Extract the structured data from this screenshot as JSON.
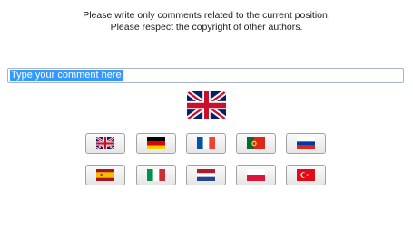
{
  "notice": {
    "line1": "Please write only comments related to the current position.",
    "line2": "Please respect the copyright of other authors."
  },
  "comment": {
    "value": "Type your comment here"
  },
  "selected_flag": "uk-flag-icon",
  "language_buttons": [
    {
      "icon": "uk-flag-icon"
    },
    {
      "icon": "germany-flag-icon"
    },
    {
      "icon": "france-flag-icon"
    },
    {
      "icon": "portugal-flag-icon"
    },
    {
      "icon": "russia-flag-icon"
    },
    {
      "icon": "spain-flag-icon"
    },
    {
      "icon": "italy-flag-icon"
    },
    {
      "icon": "netherlands-flag-icon"
    },
    {
      "icon": "poland-flag-icon"
    },
    {
      "icon": "turkey-flag-icon"
    }
  ]
}
